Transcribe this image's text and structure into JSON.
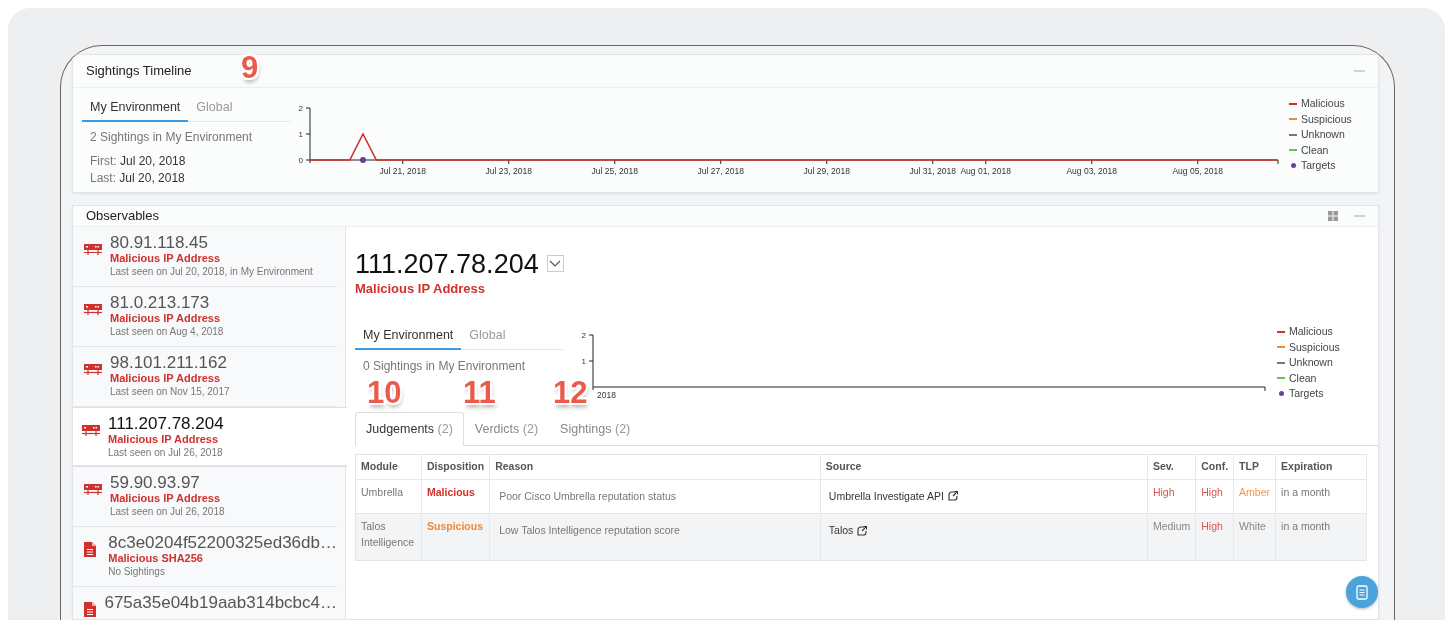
{
  "timeline": {
    "title": "Sightings Timeline",
    "tabs": [
      {
        "label": "My Environment",
        "selected": true
      },
      {
        "label": "Global",
        "selected": false
      }
    ],
    "summary": "2 Sightings in My Environment",
    "dates": [
      {
        "label": "First:",
        "value": "Jul 20, 2018"
      },
      {
        "label": "Last:",
        "value": "Jul 20, 2018"
      }
    ],
    "chart_data": {
      "type": "line",
      "ylim": [
        0,
        2
      ],
      "yticks": [
        0,
        1,
        2
      ],
      "categories": [
        null,
        null,
        null,
        null,
        null,
        null,
        null,
        "Jul 21, 2018",
        null,
        null,
        null,
        null,
        null,
        null,
        null,
        "Jul 23, 2018",
        null,
        null,
        null,
        null,
        null,
        null,
        null,
        "Jul 25, 2018",
        null,
        null,
        null,
        null,
        null,
        null,
        null,
        "Jul 27, 2018",
        null,
        null,
        null,
        null,
        null,
        null,
        null,
        "Jul 29, 2018",
        null,
        null,
        null,
        null,
        null,
        null,
        null,
        "Jul 31, 2018",
        null,
        null,
        null,
        "Aug 01, 2018",
        null,
        null,
        null,
        null,
        null,
        null,
        null,
        "Aug 03, 2018",
        null,
        null,
        null,
        null,
        null,
        null,
        null,
        "Aug 05, 2018",
        null,
        null,
        null,
        null,
        null,
        null
      ],
      "series": [
        {
          "name": "Malicious",
          "color": "#d0312d",
          "values": [
            0,
            0,
            0,
            0,
            1,
            0,
            0,
            0,
            0,
            0,
            0,
            0,
            0,
            0,
            0,
            0,
            0,
            0,
            0,
            0,
            0,
            0,
            0,
            0,
            0,
            0,
            0,
            0,
            0,
            0,
            0,
            0,
            0,
            0,
            0,
            0,
            0,
            0,
            0,
            0,
            0,
            0,
            0,
            0,
            0,
            0,
            0,
            0,
            0,
            0,
            0,
            0,
            0,
            0,
            0,
            0,
            0,
            0,
            0,
            0,
            0,
            0,
            0,
            0,
            0,
            0,
            0,
            0,
            0,
            0,
            0,
            0,
            0,
            0
          ]
        },
        {
          "name": "Suspicious",
          "color": "#f08a33",
          "values": [
            null,
            null,
            null,
            null,
            null,
            null,
            null,
            null,
            null,
            null,
            null,
            null,
            null,
            null,
            null,
            null,
            null,
            null,
            null,
            null,
            null,
            null,
            null,
            null,
            null,
            null,
            null,
            null,
            null,
            null,
            null,
            null,
            null,
            null,
            null,
            null,
            null,
            null,
            null,
            null,
            null,
            null,
            null,
            null,
            null,
            null,
            null,
            null,
            null,
            null,
            null,
            null,
            null,
            null,
            null,
            null,
            null,
            null,
            null,
            null,
            null,
            null,
            null,
            null,
            null,
            null,
            null,
            null,
            null,
            null,
            null,
            null,
            null,
            null
          ]
        },
        {
          "name": "Unknown",
          "color": "#777777",
          "values": [
            null,
            null,
            null,
            null,
            null,
            null,
            null,
            null,
            null,
            null,
            null,
            null,
            null,
            null,
            null,
            null,
            null,
            null,
            null,
            null,
            null,
            null,
            null,
            null,
            null,
            null,
            null,
            null,
            null,
            null,
            null,
            null,
            null,
            null,
            null,
            null,
            null,
            null,
            null,
            null,
            null,
            null,
            null,
            null,
            null,
            null,
            null,
            null,
            null,
            null,
            null,
            null,
            null,
            null,
            null,
            null,
            null,
            null,
            null,
            null,
            null,
            null,
            null,
            null,
            null,
            null,
            null,
            null,
            null,
            null,
            null,
            null,
            null,
            null
          ]
        },
        {
          "name": "Clean",
          "color": "#6cc04a",
          "values": [
            null,
            null,
            null,
            null,
            null,
            null,
            null,
            null,
            null,
            null,
            null,
            null,
            null,
            null,
            null,
            null,
            null,
            null,
            null,
            null,
            null,
            null,
            null,
            null,
            null,
            null,
            null,
            null,
            null,
            null,
            null,
            null,
            null,
            null,
            null,
            null,
            null,
            null,
            null,
            null,
            null,
            null,
            null,
            null,
            null,
            null,
            null,
            null,
            null,
            null,
            null,
            null,
            null,
            null,
            null,
            null,
            null,
            null,
            null,
            null,
            null,
            null,
            null,
            null,
            null,
            null,
            null,
            null,
            null,
            null,
            null,
            null,
            null,
            null
          ]
        },
        {
          "name": "Targets",
          "color": "#6b3fa0",
          "marker": "circle",
          "values": [
            null,
            null,
            null,
            null,
            0,
            null,
            null,
            null,
            null,
            null,
            null,
            null,
            null,
            null,
            null,
            null,
            null,
            null,
            null,
            null,
            null,
            null,
            null,
            null,
            null,
            null,
            null,
            null,
            null,
            null,
            null,
            null,
            null,
            null,
            null,
            null,
            null,
            null,
            null,
            null,
            null,
            null,
            null,
            null,
            null,
            null,
            null,
            null,
            null,
            null,
            null,
            null,
            null,
            null,
            null,
            null,
            null,
            null,
            null,
            null,
            null,
            null,
            null,
            null,
            null,
            null,
            null,
            null,
            null,
            null,
            null,
            null,
            null,
            null
          ]
        }
      ]
    }
  },
  "observables": {
    "title": "Observables",
    "items": [
      {
        "kind": "ip",
        "value": "80.91.118.45",
        "type": "Malicious IP Address",
        "last_seen": "Last seen on Jul 20, 2018, in My Environment",
        "selected": false
      },
      {
        "kind": "ip",
        "value": "81.0.213.173",
        "type": "Malicious IP Address",
        "last_seen": "Last seen on Aug 4, 2018",
        "selected": false
      },
      {
        "kind": "ip",
        "value": "98.101.211.162",
        "type": "Malicious IP Address",
        "last_seen": "Last seen on Nov 15, 2017",
        "selected": false
      },
      {
        "kind": "ip",
        "value": "111.207.78.204",
        "type": "Malicious IP Address",
        "last_seen": "Last seen on Jul 26, 2018",
        "selected": true
      },
      {
        "kind": "ip",
        "value": "59.90.93.97",
        "type": "Malicious IP Address",
        "last_seen": "Last seen on Jul 26, 2018",
        "selected": false
      },
      {
        "kind": "file",
        "value": "8c3e0204f52200325ed36db…",
        "type": "Malicious SHA256",
        "last_seen": "No Sightings",
        "selected": false
      },
      {
        "kind": "file",
        "value": "675a35e04b19aab314bcbc4…",
        "selected": false
      }
    ],
    "detail": {
      "value": "111.207.78.204",
      "type": "Malicious IP Address",
      "tabs": [
        {
          "label": "My Environment",
          "selected": true
        },
        {
          "label": "Global",
          "selected": false
        }
      ],
      "summary": "0 Sightings in My Environment",
      "chart": {
        "y_labels": [
          "2",
          "1"
        ],
        "x_label": "2018"
      },
      "legend": [
        {
          "name": "Malicious",
          "color": "#d0312d"
        },
        {
          "name": "Suspicious",
          "color": "#f08a33"
        },
        {
          "name": "Unknown",
          "color": "#777777"
        },
        {
          "name": "Clean",
          "color": "#6cc04a"
        },
        {
          "name": "Targets",
          "color": "#6b3fa0"
        }
      ],
      "result_tabs": [
        {
          "label": "Judgements",
          "count": "(2)",
          "selected": true
        },
        {
          "label": "Verdicts",
          "count": "(2)",
          "selected": false
        },
        {
          "label": "Sightings",
          "count": "(2)",
          "selected": false
        }
      ],
      "table": {
        "columns": [
          "Module",
          "Disposition",
          "Reason",
          "Source",
          "Sev.",
          "Conf.",
          "TLP",
          "Expiration"
        ],
        "rows": [
          {
            "module": "Umbrella",
            "disposition": {
              "text": "Malicious",
              "color": "#d0312d"
            },
            "reason": "Poor Cisco Umbrella reputation status",
            "source": "Umbrella Investigate API",
            "severity": {
              "text": "High",
              "color": "#d9534f"
            },
            "confidence": {
              "text": "High",
              "color": "#d9534f"
            },
            "tlp": {
              "text": "Amber",
              "color": "#f0954a"
            },
            "expiration": "in a month"
          },
          {
            "module": "Talos Intelligence",
            "disposition": {
              "text": "Suspicious",
              "color": "#f08a33"
            },
            "reason": "Low Talos Intelligence reputation score",
            "source": "Talos",
            "severity": {
              "text": "Medium",
              "color": "#888888"
            },
            "confidence": {
              "text": "High",
              "color": "#d9534f"
            },
            "tlp": {
              "text": "White",
              "color": "#888888"
            },
            "expiration": "in a month"
          }
        ]
      }
    }
  },
  "callouts": [
    {
      "label": "9"
    },
    {
      "label": "10"
    },
    {
      "label": "11"
    },
    {
      "label": "12"
    }
  ]
}
